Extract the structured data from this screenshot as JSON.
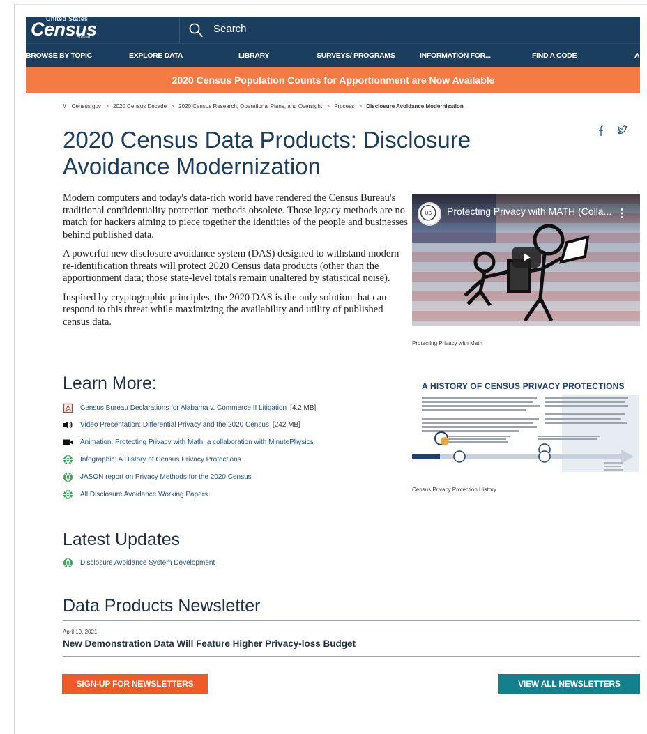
{
  "header": {
    "logo": {
      "top": "United States",
      "main": "Census",
      "sub": "Bureau"
    },
    "search_label": "Search"
  },
  "nav": {
    "items": [
      "BROWSE BY TOPIC",
      "EXPLORE DATA",
      "LIBRARY",
      "SURVEYS/ PROGRAMS",
      "INFORMATION FOR...",
      "FIND A CODE",
      "A"
    ]
  },
  "banner": {
    "text": "2020 Census Population Counts for Apportionment are Now Available",
    "color": "#f47c44"
  },
  "breadcrumb": {
    "items": [
      "Census.gov",
      "2020 Census Decade",
      "2020 Census Research, Operational Plans, and Oversight",
      "Process"
    ],
    "current": "Disclosure Avoidance Modernization"
  },
  "page": {
    "title": "2020 Census Data Products: Disclosure Avoidance Modernization",
    "paragraphs": [
      "Modern computers and today's data-rich world have rendered the Census Bureau's traditional confidentiality protection methods obsolete. Those legacy methods are no match for hackers aiming to piece together the identities of the people and businesses behind published data.",
      "A powerful new disclosure avoidance system (DAS) designed to withstand modern re-identification threats will protect 2020 Census data products (other than the apportionment data; those state-level totals remain unaltered by statistical noise).",
      "Inspired by cryptographic principles, the 2020 DAS is the only solution that can respond to this threat while maximizing the availability and utility of published census data."
    ]
  },
  "video": {
    "title": "Protecting Privacy with MATH (Colla...",
    "menu": "⋮",
    "caption": "Protecting Privacy with Math"
  },
  "infographic": {
    "title": "A HISTORY OF CENSUS PRIVACY PROTECTIONS",
    "caption": "Census Privacy Protection History"
  },
  "learn_more": {
    "heading": "Learn More:",
    "links": [
      {
        "icon": "pdf-icon",
        "label": "Census Bureau Declarations for Alabama v. Commerce II Litigation",
        "size": "[4.2 MB]"
      },
      {
        "icon": "audio-icon",
        "label": "Video Presentation: Differential Privacy and the 2020 Census",
        "size": "[242 MB]"
      },
      {
        "icon": "video-camera-icon",
        "label": "Animation: Protecting Privacy with Math, a collaboration with MinutePhysics",
        "size": ""
      },
      {
        "icon": "globe-icon",
        "label": "Infographic: A History of Census Privacy Protections",
        "size": ""
      },
      {
        "icon": "globe-icon",
        "label": "JASON report on Privacy Methods for the 2020 Census",
        "size": ""
      },
      {
        "icon": "globe-icon",
        "label": "All Disclosure Avoidance Working Papers",
        "size": ""
      }
    ]
  },
  "latest_updates": {
    "heading": "Latest Updates",
    "links": [
      {
        "icon": "globe-icon",
        "label": "Disclosure Avoidance System Development"
      }
    ]
  },
  "newsletter": {
    "heading": "Data Products Newsletter",
    "date": "April 19, 2021",
    "title": "New Demonstration Data Will Feature Higher Privacy-loss Budget",
    "signup_label": "SIGN-UP FOR NEWSLETTERS",
    "view_all_label": "VIEW ALL NEWSLETTERS"
  },
  "colors": {
    "navy": "#1b3d5e",
    "orange": "#f47c44",
    "button_orange": "#f05a28",
    "teal": "#13808e",
    "link": "#1e4f7a",
    "globe_green": "#3aa35a",
    "pdf_red": "#d9342b"
  }
}
